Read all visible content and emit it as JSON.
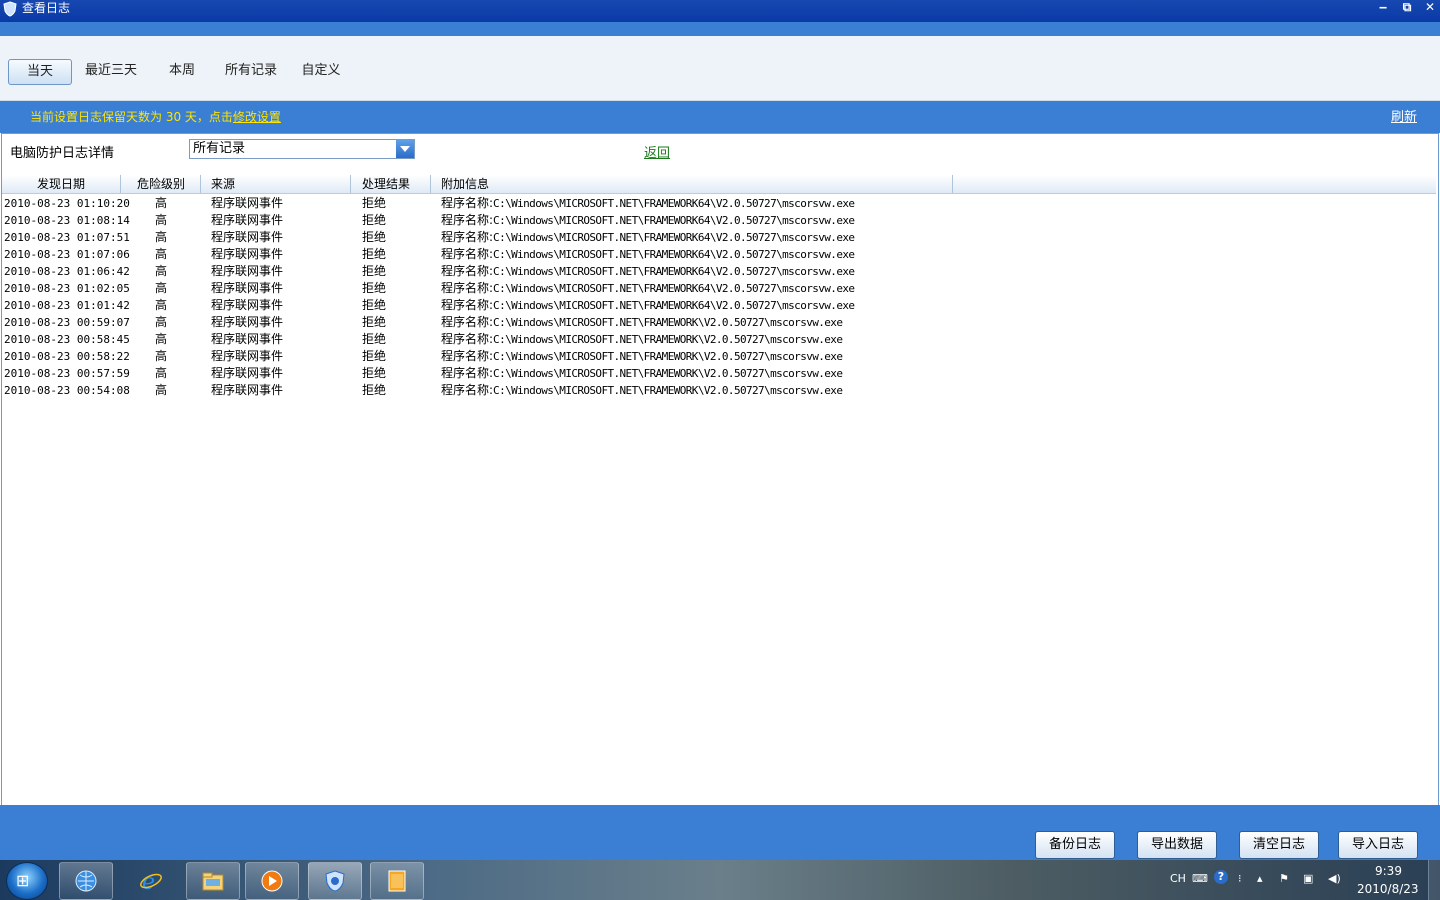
{
  "window": {
    "title": "查看日志",
    "min_label": "‒",
    "restore_label": "⧉",
    "close_label": "✕"
  },
  "tabs": [
    "当天",
    "最近三天",
    "本周",
    "所有记录",
    "自定义"
  ],
  "infobar": {
    "text": "当前设置日志保留天数为 30 天，点击",
    "link": "修改设置",
    "refresh": "刷新"
  },
  "filter": {
    "label": "电脑防护日志详情",
    "value": "所有记录",
    "back": "返回"
  },
  "table": {
    "headers": [
      "发现日期",
      "危险级别",
      "来源",
      "处理结果",
      "附加信息"
    ],
    "rows": [
      {
        "date": "2010-08-23 01:10:20",
        "level": "高",
        "source": "程序联网事件",
        "result": "拒绝",
        "info_prefix": "程序名称:",
        "info_path": "C:\\Windows\\MICROSOFT.NET\\FRAMEWORK64\\V2.0.50727\\mscorsvw.exe"
      },
      {
        "date": "2010-08-23 01:08:14",
        "level": "高",
        "source": "程序联网事件",
        "result": "拒绝",
        "info_prefix": "程序名称:",
        "info_path": "C:\\Windows\\MICROSOFT.NET\\FRAMEWORK64\\V2.0.50727\\mscorsvw.exe"
      },
      {
        "date": "2010-08-23 01:07:51",
        "level": "高",
        "source": "程序联网事件",
        "result": "拒绝",
        "info_prefix": "程序名称:",
        "info_path": "C:\\Windows\\MICROSOFT.NET\\FRAMEWORK64\\V2.0.50727\\mscorsvw.exe"
      },
      {
        "date": "2010-08-23 01:07:06",
        "level": "高",
        "source": "程序联网事件",
        "result": "拒绝",
        "info_prefix": "程序名称:",
        "info_path": "C:\\Windows\\MICROSOFT.NET\\FRAMEWORK64\\V2.0.50727\\mscorsvw.exe"
      },
      {
        "date": "2010-08-23 01:06:42",
        "level": "高",
        "source": "程序联网事件",
        "result": "拒绝",
        "info_prefix": "程序名称:",
        "info_path": "C:\\Windows\\MICROSOFT.NET\\FRAMEWORK64\\V2.0.50727\\mscorsvw.exe"
      },
      {
        "date": "2010-08-23 01:02:05",
        "level": "高",
        "source": "程序联网事件",
        "result": "拒绝",
        "info_prefix": "程序名称:",
        "info_path": "C:\\Windows\\MICROSOFT.NET\\FRAMEWORK64\\V2.0.50727\\mscorsvw.exe"
      },
      {
        "date": "2010-08-23 01:01:42",
        "level": "高",
        "source": "程序联网事件",
        "result": "拒绝",
        "info_prefix": "程序名称:",
        "info_path": "C:\\Windows\\MICROSOFT.NET\\FRAMEWORK64\\V2.0.50727\\mscorsvw.exe"
      },
      {
        "date": "2010-08-23 00:59:07",
        "level": "高",
        "source": "程序联网事件",
        "result": "拒绝",
        "info_prefix": "程序名称:",
        "info_path": "C:\\Windows\\MICROSOFT.NET\\FRAMEWORK\\V2.0.50727\\mscorsvw.exe"
      },
      {
        "date": "2010-08-23 00:58:45",
        "level": "高",
        "source": "程序联网事件",
        "result": "拒绝",
        "info_prefix": "程序名称:",
        "info_path": "C:\\Windows\\MICROSOFT.NET\\FRAMEWORK\\V2.0.50727\\mscorsvw.exe"
      },
      {
        "date": "2010-08-23 00:58:22",
        "level": "高",
        "source": "程序联网事件",
        "result": "拒绝",
        "info_prefix": "程序名称:",
        "info_path": "C:\\Windows\\MICROSOFT.NET\\FRAMEWORK\\V2.0.50727\\mscorsvw.exe"
      },
      {
        "date": "2010-08-23 00:57:59",
        "level": "高",
        "source": "程序联网事件",
        "result": "拒绝",
        "info_prefix": "程序名称:",
        "info_path": "C:\\Windows\\MICROSOFT.NET\\FRAMEWORK\\V2.0.50727\\mscorsvw.exe"
      },
      {
        "date": "2010-08-23 00:54:08",
        "level": "高",
        "source": "程序联网事件",
        "result": "拒绝",
        "info_prefix": "程序名称:",
        "info_path": "C:\\Windows\\MICROSOFT.NET\\FRAMEWORK\\V2.0.50727\\mscorsvw.exe"
      }
    ]
  },
  "buttons": {
    "backup": "备份日志",
    "export": "导出数据",
    "clear": "清空日志",
    "import": "导入日志"
  },
  "taskbar": {
    "apps": [
      "ie-globe-icon",
      "internet-explorer-icon",
      "file-explorer-icon",
      "media-player-icon",
      "security-shield-icon",
      "notepad-icon"
    ],
    "lang": "CH",
    "time": "9:39",
    "date": "2010/8/23"
  },
  "colors": {
    "titlebar": "#0a3aa6",
    "accent": "#3a7fd4",
    "info_text": "#ffe400",
    "link_green": "#1a7a1a"
  }
}
